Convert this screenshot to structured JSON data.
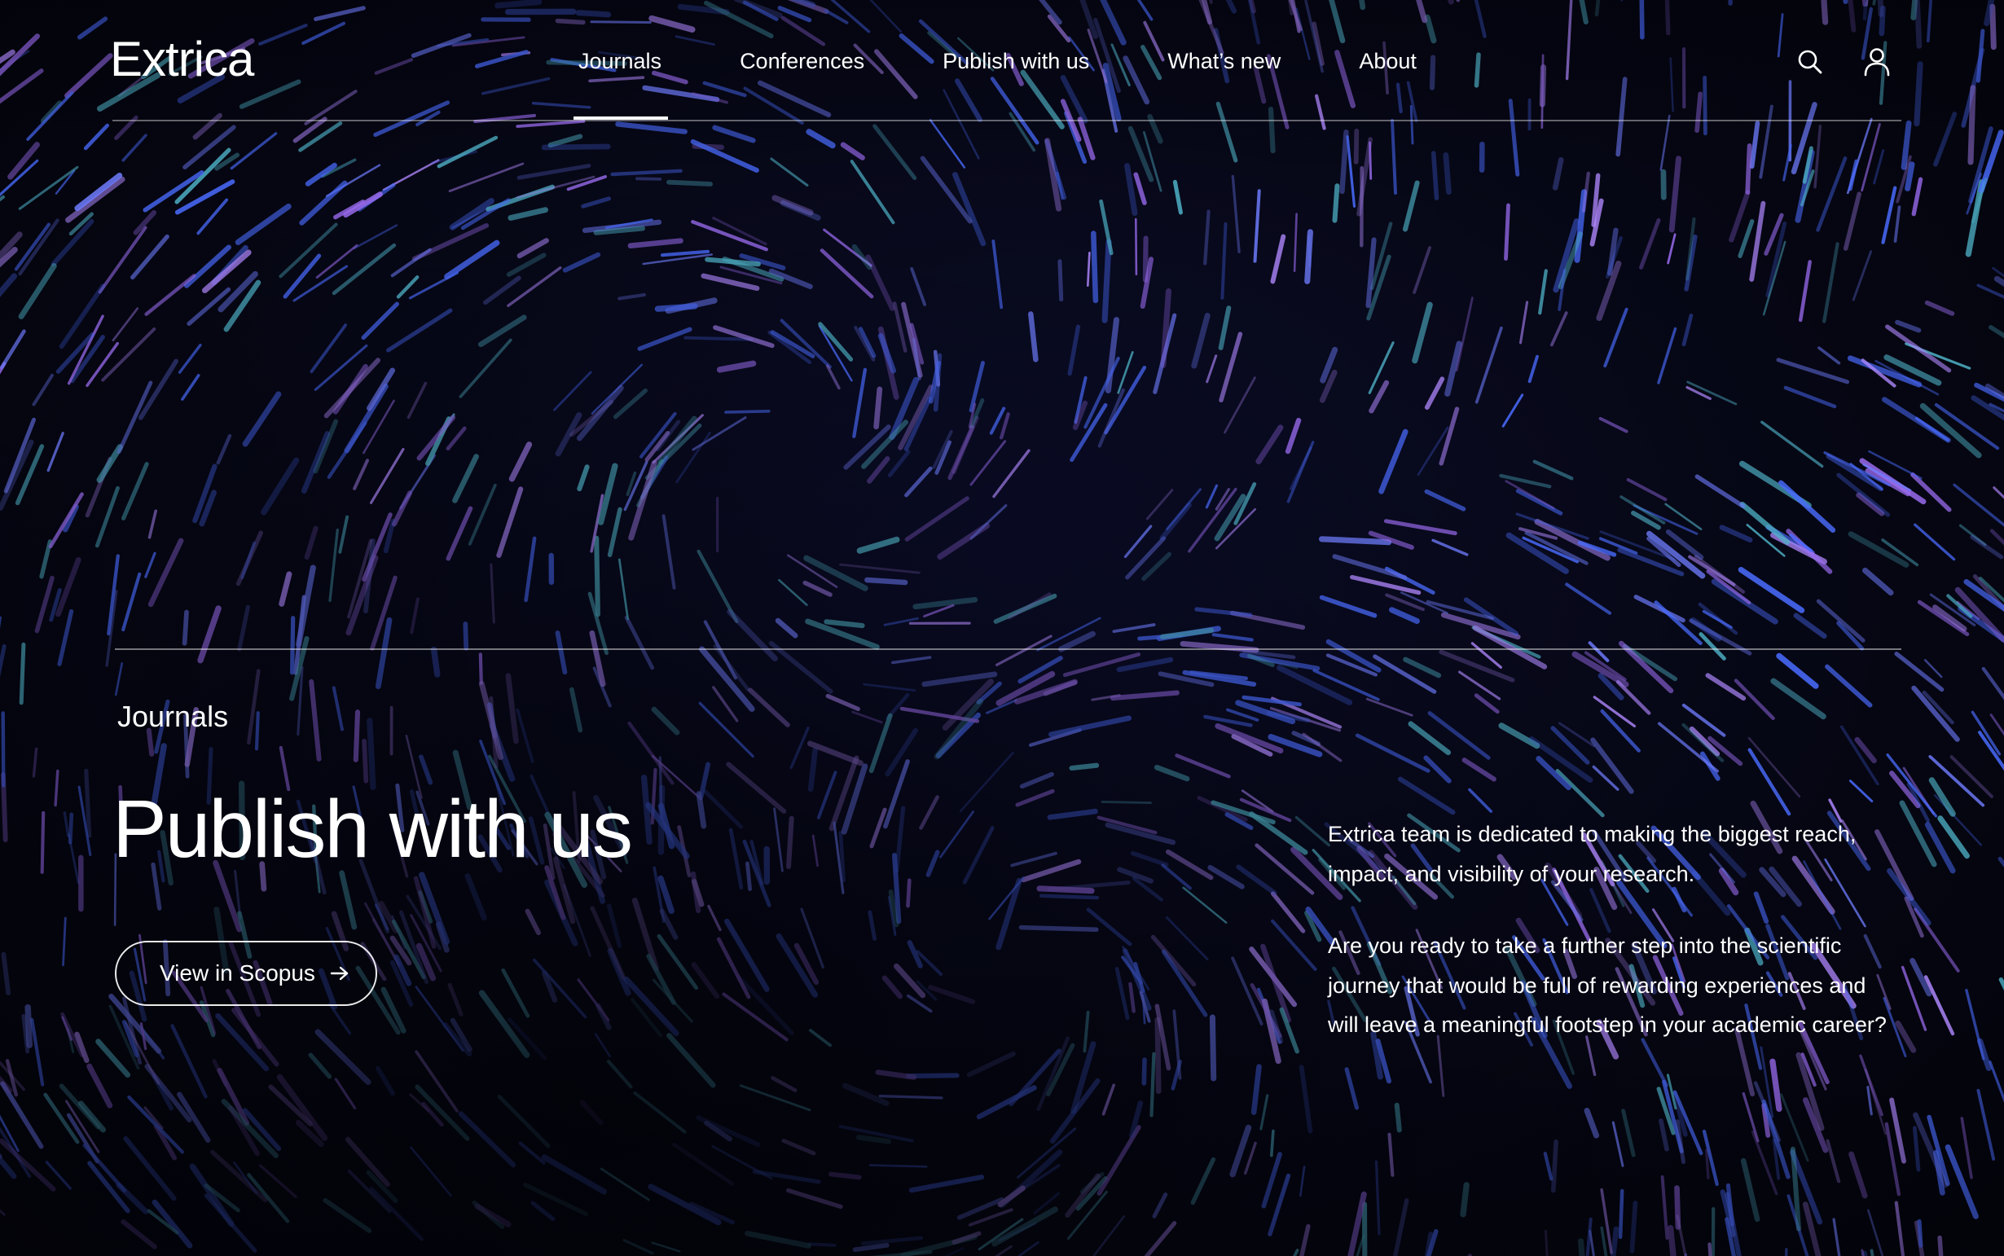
{
  "header": {
    "logo": "Extrica",
    "nav": [
      {
        "label": "Journals",
        "active": true
      },
      {
        "label": "Conferences",
        "active": false
      },
      {
        "label": "Publish with us",
        "active": false
      },
      {
        "label": "What’s new",
        "active": false
      },
      {
        "label": "About",
        "active": false
      }
    ],
    "icons": [
      "search-icon",
      "user-icon"
    ]
  },
  "hero": {
    "section_label": "Journals",
    "title": "Publish with us",
    "cta": {
      "label": "View in Scopus",
      "icon": "arrow-right-icon"
    },
    "paragraphs": [
      "Extrica team is dedicated to making the biggest reach, impact, and visibility of your research.",
      "Are you ready to take a further step into the scientific journey that would be full of rewarding experiences and will leave a meaningful footstep in your academic career?"
    ]
  },
  "colors": {
    "background": "#05050f",
    "text": "#ffffff",
    "streak_blue": "#4a6cff",
    "streak_violet": "#9a6cf0",
    "streak_teal": "#4fb3c8"
  }
}
